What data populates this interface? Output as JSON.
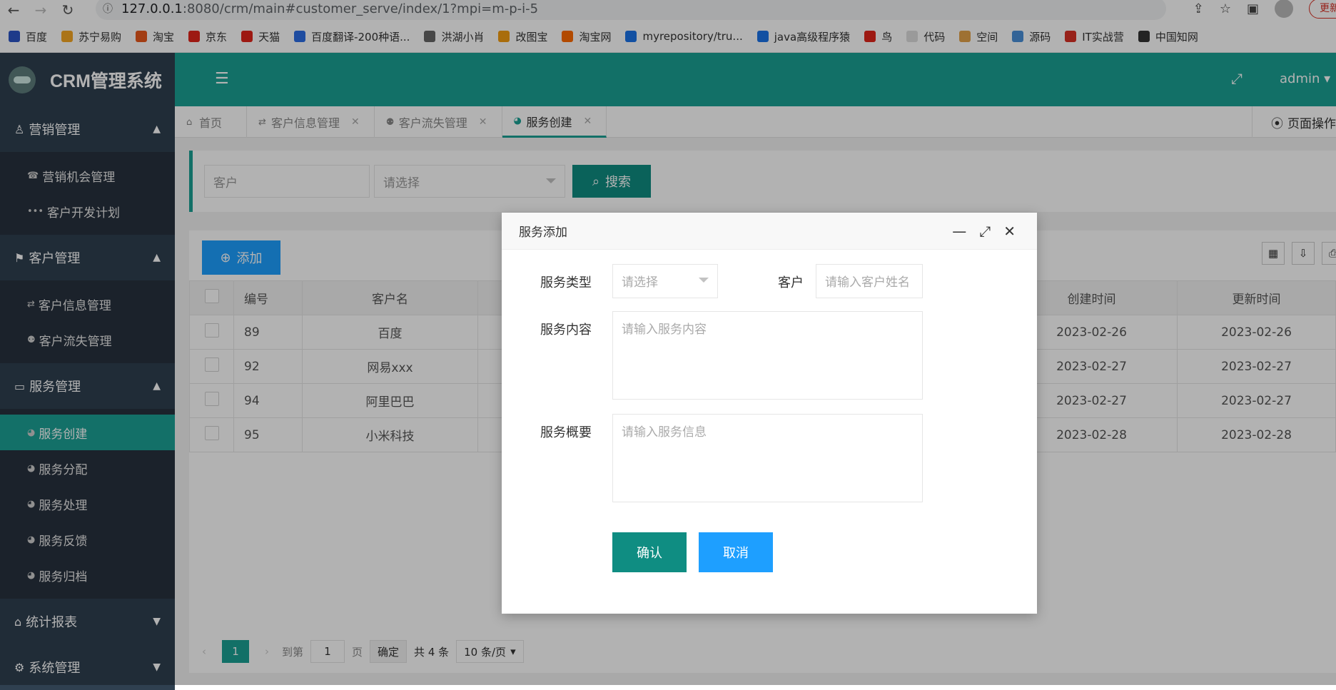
{
  "browser": {
    "url_host": "127.0.0.1",
    "url_path": ":8080/crm/main#customer_serve/index/1?mpi=m-p-i-5",
    "update_label": "更新",
    "bookmarks": [
      "百度",
      "苏宁易购",
      "淘宝",
      "京东",
      "天猫",
      "百度翻译-200种语...",
      "洪湖小肖",
      "改图宝",
      "淘宝网",
      "myrepository/tru...",
      "java高级程序猿",
      "鸟",
      "代码",
      "空间",
      "源码",
      "IT实战营",
      "中国知网"
    ],
    "bookmark_colors": [
      "#2b55c6",
      "#f5a623",
      "#e8581c",
      "#e1251b",
      "#e1251b",
      "#2b6de6",
      "#666",
      "#f39c12",
      "#ff6a00",
      "#1a73e8",
      "#1a73e8",
      "#e1251b",
      "#ddd",
      "#e2a34a",
      "#4a90d9",
      "#d93025",
      "#333"
    ]
  },
  "sidebar": {
    "title": "CRM管理系统",
    "groups": [
      {
        "label": "营销管理",
        "icon": "user-icon",
        "arrow": "▲",
        "items": [
          "营销机会管理",
          "客户开发计划"
        ]
      },
      {
        "label": "客户管理",
        "icon": "flag-icon",
        "arrow": "▲",
        "items": [
          "客户信息管理",
          "客户流失管理"
        ]
      },
      {
        "label": "服务管理",
        "icon": "desktop-icon",
        "arrow": "▲",
        "items": [
          "服务创建",
          "服务分配",
          "服务处理",
          "服务反馈",
          "服务归档"
        ]
      },
      {
        "label": "统计报表",
        "icon": "home-icon",
        "arrow": "▼",
        "items": []
      },
      {
        "label": "系统管理",
        "icon": "gears-icon",
        "arrow": "▼",
        "items": []
      }
    ]
  },
  "header": {
    "admin_label": "admin ▾"
  },
  "tabs": [
    {
      "label": "首页",
      "icon": "home-icon",
      "closable": false
    },
    {
      "label": "客户信息管理",
      "icon": "exchange-icon",
      "closable": true
    },
    {
      "label": "客户流失管理",
      "icon": "user-times-icon",
      "closable": true
    },
    {
      "label": "服务创建",
      "icon": "dashboard-icon",
      "closable": true
    }
  ],
  "page_ops_label": "页面操作",
  "search": {
    "customer_placeholder": "客户",
    "select_placeholder": "请选择",
    "button_label": "搜索"
  },
  "toolbar": {
    "add_label": "添加"
  },
  "table": {
    "columns": [
      "编号",
      "客户名",
      "创建时间",
      "更新时间"
    ],
    "rows": [
      {
        "id": "89",
        "name": "百度",
        "created": "2023-02-26",
        "updated": "2023-02-26"
      },
      {
        "id": "92",
        "name": "网易xxx",
        "created": "2023-02-27",
        "updated": "2023-02-27"
      },
      {
        "id": "94",
        "name": "阿里巴巴",
        "created": "2023-02-27",
        "updated": "2023-02-27"
      },
      {
        "id": "95",
        "name": "小米科技",
        "created": "2023-02-28",
        "updated": "2023-02-28"
      }
    ]
  },
  "pager": {
    "current": "1",
    "goto_label": "到第",
    "page_value": "1",
    "page_unit": "页",
    "confirm_label": "确定",
    "total_label": "共 4 条",
    "size_label": "10 条/页"
  },
  "modal": {
    "title": "服务添加",
    "type_label": "服务类型",
    "type_placeholder": "请选择",
    "customer_label": "客户",
    "customer_placeholder": "请输入客户姓名",
    "content_label": "服务内容",
    "content_placeholder": "请输入服务内容",
    "summary_label": "服务概要",
    "summary_placeholder": "请输入服务信息",
    "confirm_label": "确认",
    "cancel_label": "取消"
  },
  "colors": {
    "primary": "#1aa194",
    "sidebar": "#28323e",
    "add_button": "#1e9fff"
  }
}
